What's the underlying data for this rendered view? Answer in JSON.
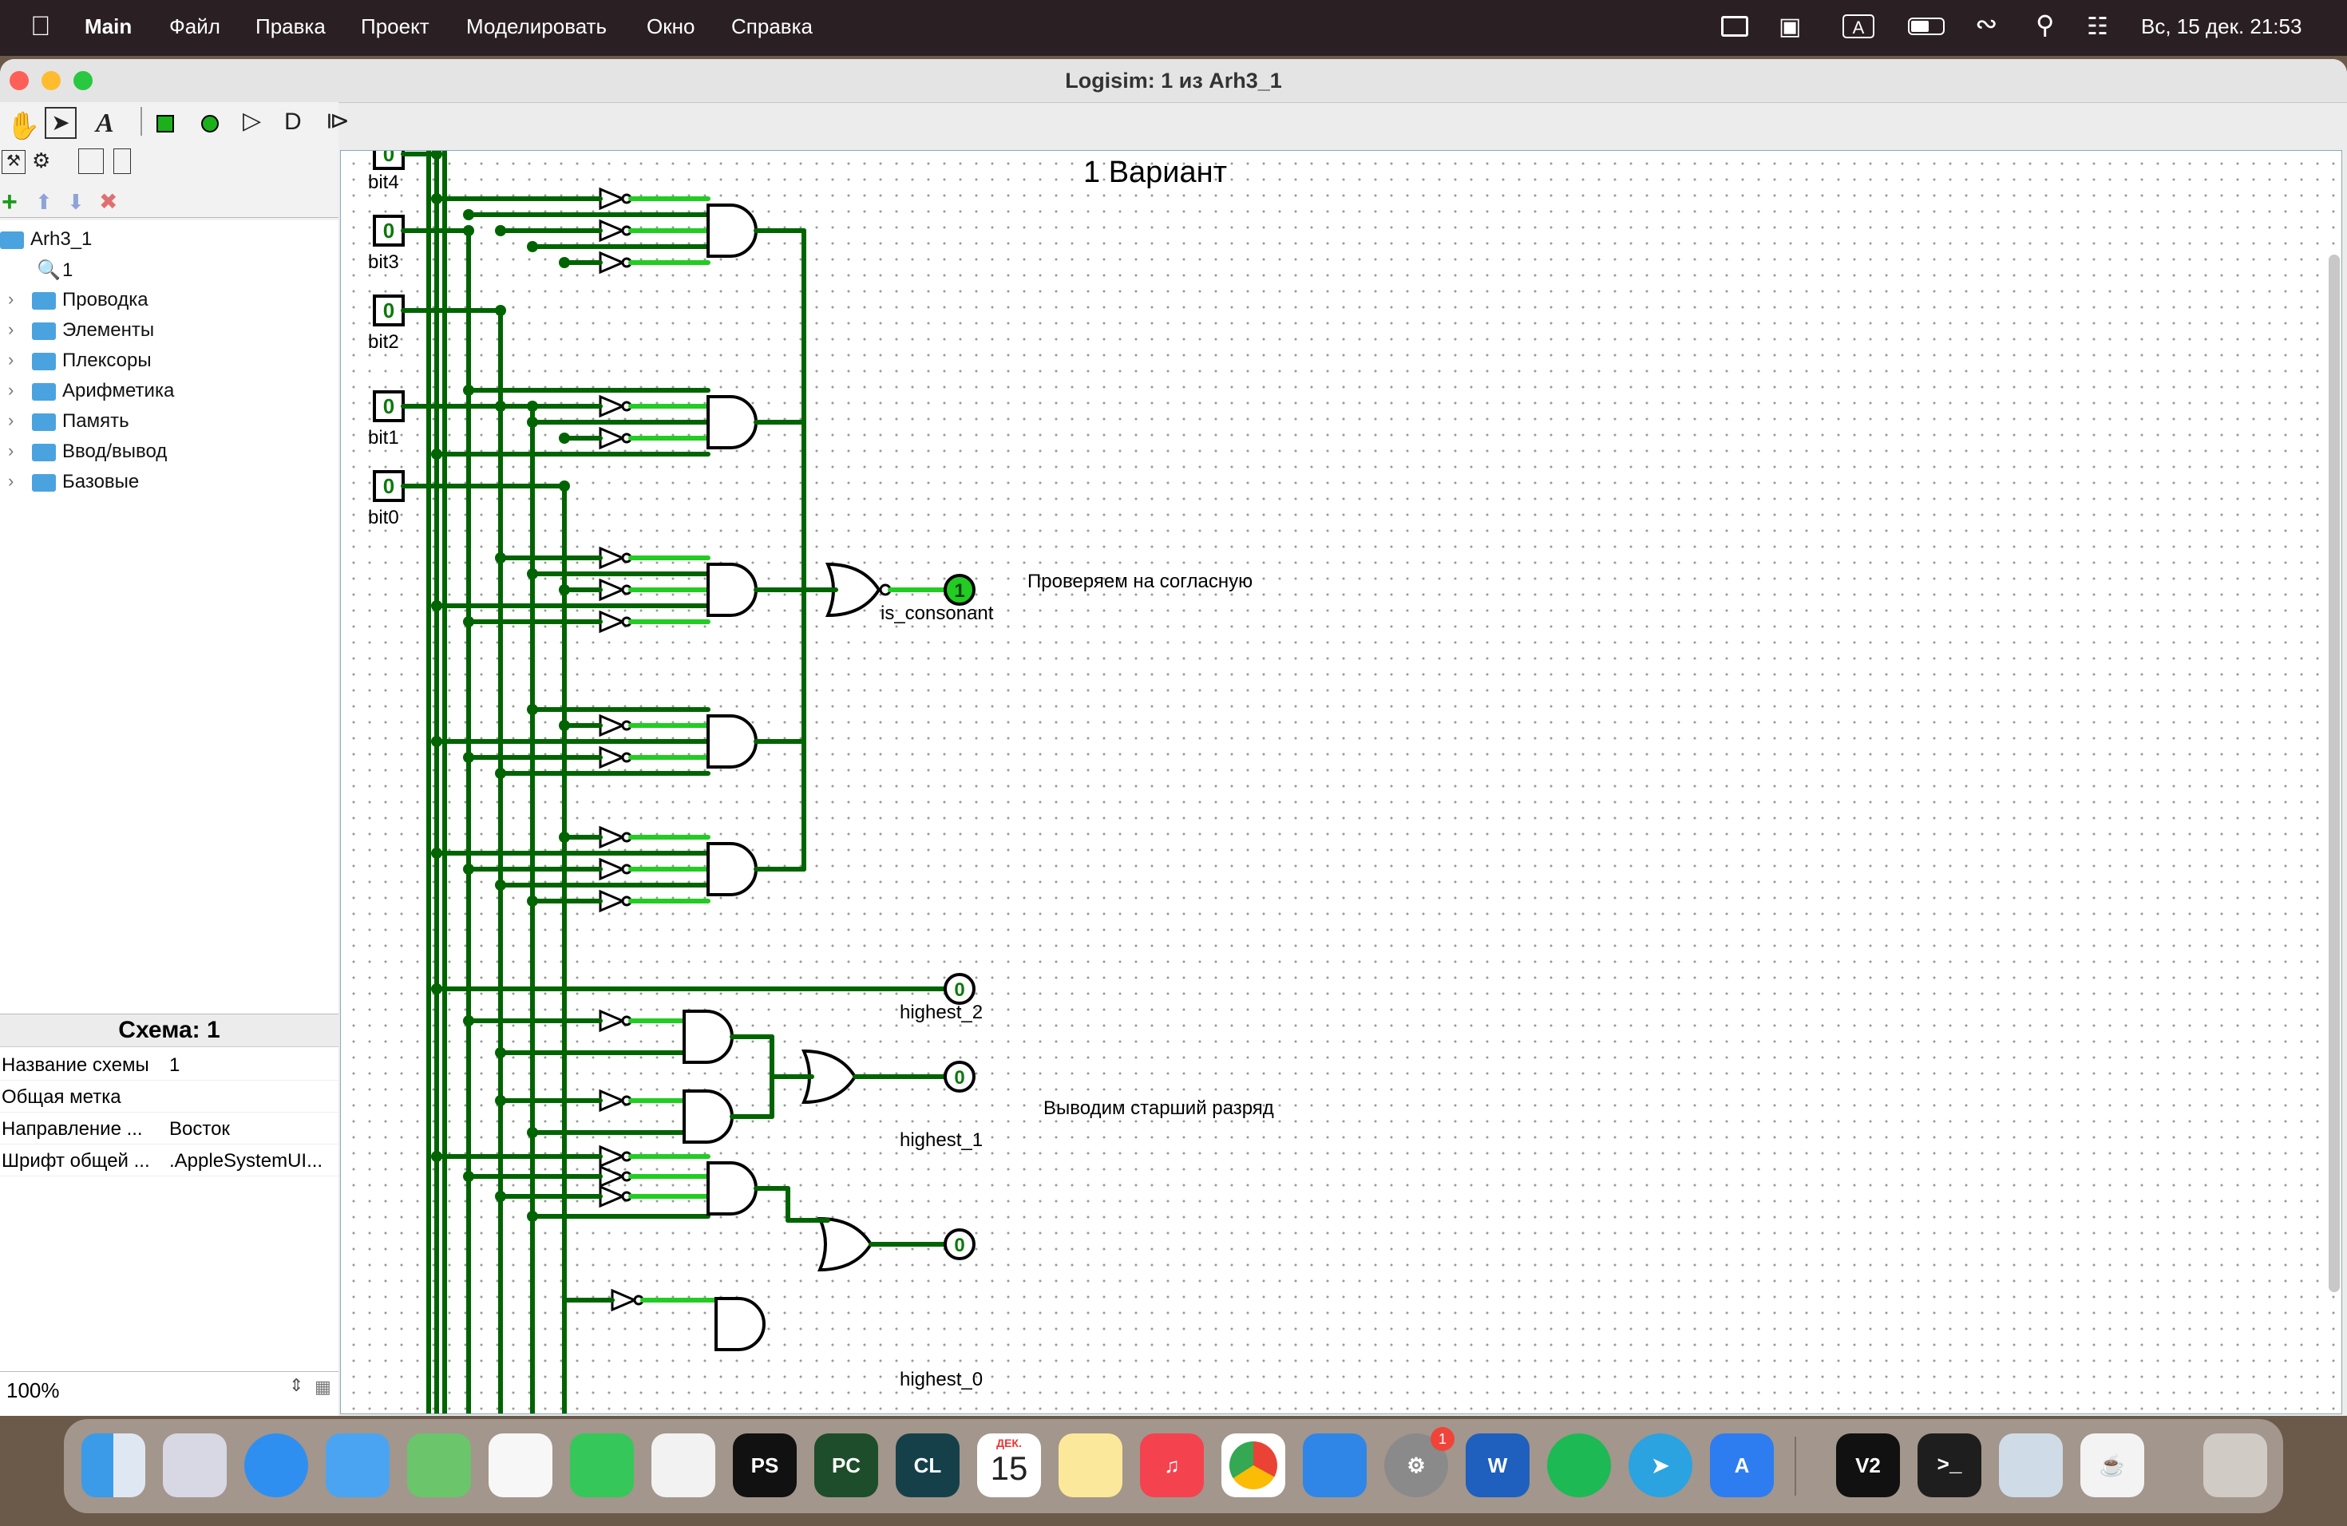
{
  "menubar": {
    "app": "Main",
    "items": [
      "Файл",
      "Правка",
      "Проект",
      "Моделировать",
      "Окно",
      "Справка"
    ],
    "kbd": "A",
    "clock": "Вс, 15 дек.  21:53"
  },
  "window": {
    "title": "Logisim: 1 из Arh3_1"
  },
  "toolbar": {
    "text_tool": "A"
  },
  "tree": {
    "project": "Arh3_1",
    "circuit": "1",
    "libraries": [
      "Проводка",
      "Элементы",
      "Плексоры",
      "Арифметика",
      "Память",
      "Ввод/вывод",
      "Базовые"
    ]
  },
  "attributes": {
    "title": "Схема: 1",
    "rows": [
      {
        "key": "Название схемы",
        "value": "1"
      },
      {
        "key": "Общая метка",
        "value": ""
      },
      {
        "key": "Направление ...",
        "value": "Восток"
      },
      {
        "key": "Шрифт общей ...",
        "value": ".AppleSystemUI..."
      }
    ]
  },
  "zoom": "100%",
  "circuit": {
    "heading": "1 Вариант",
    "inputs": [
      {
        "label": "bit4",
        "value": "0"
      },
      {
        "label": "bit3",
        "value": "0"
      },
      {
        "label": "bit2",
        "value": "0"
      },
      {
        "label": "bit1",
        "value": "0"
      },
      {
        "label": "bit0",
        "value": "0"
      }
    ],
    "outputs": [
      {
        "label": "is_consonant",
        "value": "1"
      },
      {
        "label": "highest_2",
        "value": "0"
      },
      {
        "label": "highest_1",
        "value": "0"
      },
      {
        "label": "highest_0",
        "value": "0"
      }
    ],
    "comments": [
      "Проверяем на согласную",
      "Выводим старший разряд"
    ],
    "colors": {
      "wire_low": "#006400",
      "wire_high": "#22cc22",
      "gate": "#000000"
    }
  },
  "dock": {
    "badge": "1",
    "icons": [
      "finder-icon",
      "launchpad-icon",
      "safari-icon",
      "mail-icon",
      "maps-icon",
      "photos-icon",
      "facetime-icon",
      "textedit-icon",
      "phpstorm-icon",
      "pycharm-icon",
      "clion-icon",
      "calendar-icon",
      "notes-icon",
      "music-icon",
      "chrome-icon",
      "keynote-icon",
      "system-settings-icon",
      "word-icon",
      "spotify-icon",
      "telegram-icon",
      "app-store-icon",
      "v2-icon",
      "terminal-icon",
      "preview-icon",
      "java-icon",
      "trash-icon"
    ],
    "labels": {
      "ps": "PS",
      "pc": "PC",
      "cl": "CL",
      "cal_month": "ДЕК.",
      "cal_day": "15",
      "word": "W",
      "v2": "V2",
      "term": ">_"
    }
  }
}
